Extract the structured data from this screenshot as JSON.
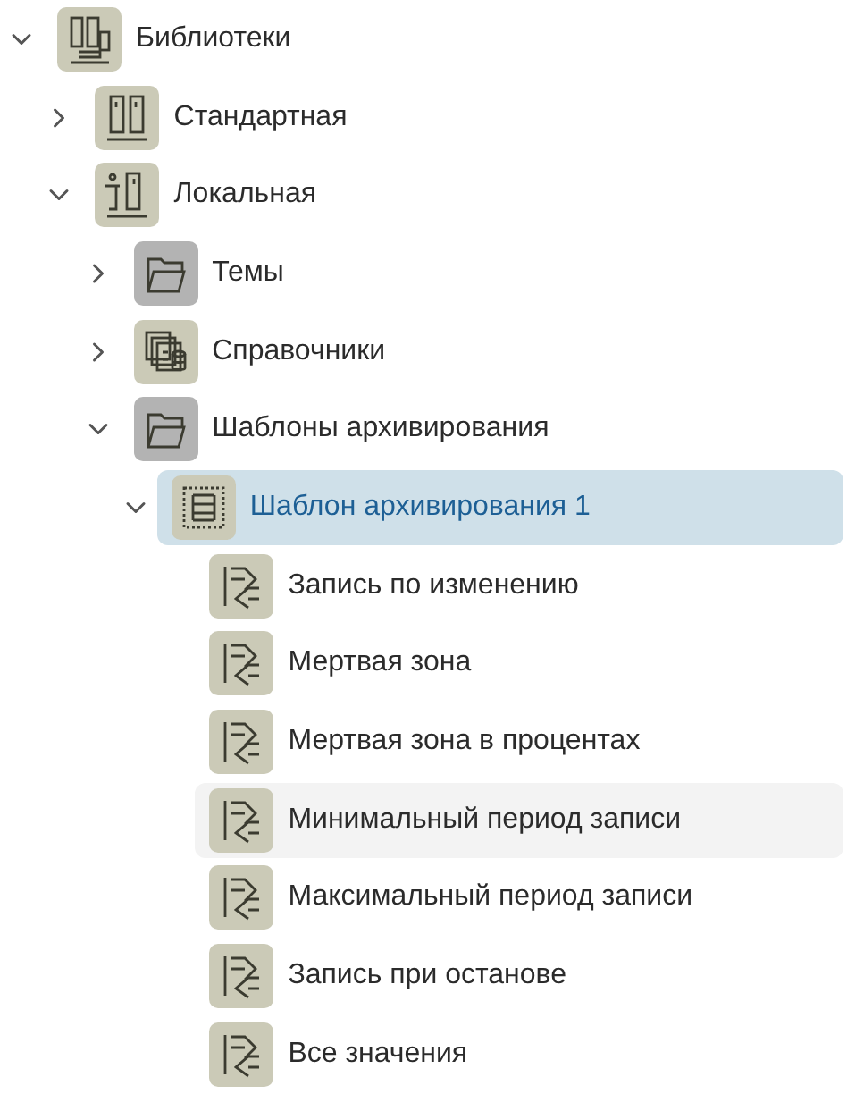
{
  "tree": [
    {
      "label": "Библиотеки",
      "kind": "library",
      "expanded": true,
      "selected": false,
      "hovered": false,
      "children": [
        {
          "label": "Стандартная",
          "kind": "storage",
          "expanded": false,
          "selected": false,
          "hovered": false
        },
        {
          "label": "Локальная",
          "kind": "local-storage",
          "expanded": true,
          "selected": false,
          "hovered": false,
          "children": [
            {
              "label": "Темы",
              "kind": "folder",
              "expanded": false,
              "selected": false,
              "hovered": false
            },
            {
              "label": "Справочники",
              "kind": "directory",
              "expanded": false,
              "selected": false,
              "hovered": false
            },
            {
              "label": "Шаблоны архивирования",
              "kind": "folder",
              "expanded": true,
              "selected": false,
              "hovered": false,
              "children": [
                {
                  "label": "Шаблон архивирования 1",
                  "kind": "template",
                  "expanded": true,
                  "selected": true,
                  "hovered": false,
                  "children": [
                    {
                      "label": "Запись по изменению",
                      "kind": "rule",
                      "selected": false,
                      "hovered": false
                    },
                    {
                      "label": "Мертвая зона",
                      "kind": "rule",
                      "selected": false,
                      "hovered": false
                    },
                    {
                      "label": "Мертвая зона в процентах",
                      "kind": "rule",
                      "selected": false,
                      "hovered": false
                    },
                    {
                      "label": "Минимальный период записи",
                      "kind": "rule",
                      "selected": false,
                      "hovered": true
                    },
                    {
                      "label": "Максимальный период записи",
                      "kind": "rule",
                      "selected": false,
                      "hovered": false
                    },
                    {
                      "label": "Запись при останове",
                      "kind": "rule",
                      "selected": false,
                      "hovered": false
                    },
                    {
                      "label": "Все значения",
                      "kind": "rule",
                      "selected": false,
                      "hovered": false
                    }
                  ]
                }
              ]
            }
          ]
        }
      ]
    }
  ]
}
